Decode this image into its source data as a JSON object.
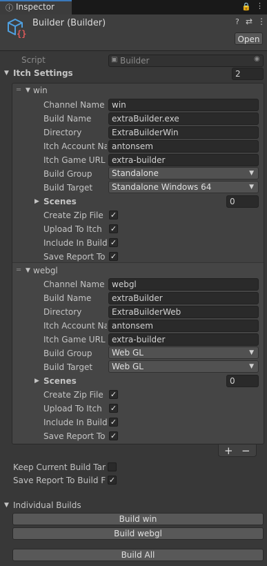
{
  "tab": {
    "icon": "info-icon",
    "title": "Inspector"
  },
  "component": {
    "title": "Builder (Builder)",
    "open_label": "Open"
  },
  "script": {
    "label": "Script",
    "value": "Builder"
  },
  "itch_settings": {
    "label": "Itch Settings",
    "count": "2"
  },
  "elements": [
    {
      "name": "win",
      "channel_name_label": "Channel Name",
      "channel_name": "win",
      "build_name_label": "Build Name",
      "build_name": "extraBuilder.exe",
      "directory_label": "Directory",
      "directory": "ExtraBuilderWin",
      "itch_account_label": "Itch Account Nar",
      "itch_account": "antonsem",
      "itch_game_url_label": "Itch Game URL",
      "itch_game_url": "extra-builder",
      "build_group_label": "Build Group",
      "build_group": "Standalone",
      "build_target_label": "Build Target",
      "build_target": "Standalone Windows 64",
      "scenes_label": "Scenes",
      "scenes_count": "0",
      "create_zip_label": "Create Zip File",
      "create_zip": true,
      "upload_label": "Upload To Itch",
      "upload": true,
      "include_label": "Include In Build",
      "include": true,
      "save_report_label": "Save Report To E",
      "save_report": true
    },
    {
      "name": "webgl",
      "channel_name_label": "Channel Name",
      "channel_name": "webgl",
      "build_name_label": "Build Name",
      "build_name": "extraBuilder",
      "directory_label": "Directory",
      "directory": "ExtraBuilderWeb",
      "itch_account_label": "Itch Account Nar",
      "itch_account": "antonsem",
      "itch_game_url_label": "Itch Game URL",
      "itch_game_url": "extra-builder",
      "build_group_label": "Build Group",
      "build_group": "Web GL",
      "build_target_label": "Build Target",
      "build_target": "Web GL",
      "scenes_label": "Scenes",
      "scenes_count": "0",
      "create_zip_label": "Create Zip File",
      "create_zip": true,
      "upload_label": "Upload To Itch",
      "upload": true,
      "include_label": "Include In Build",
      "include": true,
      "save_report_label": "Save Report To E",
      "save_report": true
    }
  ],
  "list_footer": {
    "add_label": "+",
    "remove_label": "−"
  },
  "keep_current_label": "Keep Current Build Targ",
  "keep_current": false,
  "save_report_folder_label": "Save Report To Build Fo",
  "save_report_folder": true,
  "individual_builds": {
    "label": "Individual Builds",
    "build_win": "Build win",
    "build_webgl": "Build webgl",
    "build_all": "Build All"
  },
  "colors": {
    "accent": "#3a79bb",
    "background": "#383838",
    "field": "#2a2a2a"
  }
}
